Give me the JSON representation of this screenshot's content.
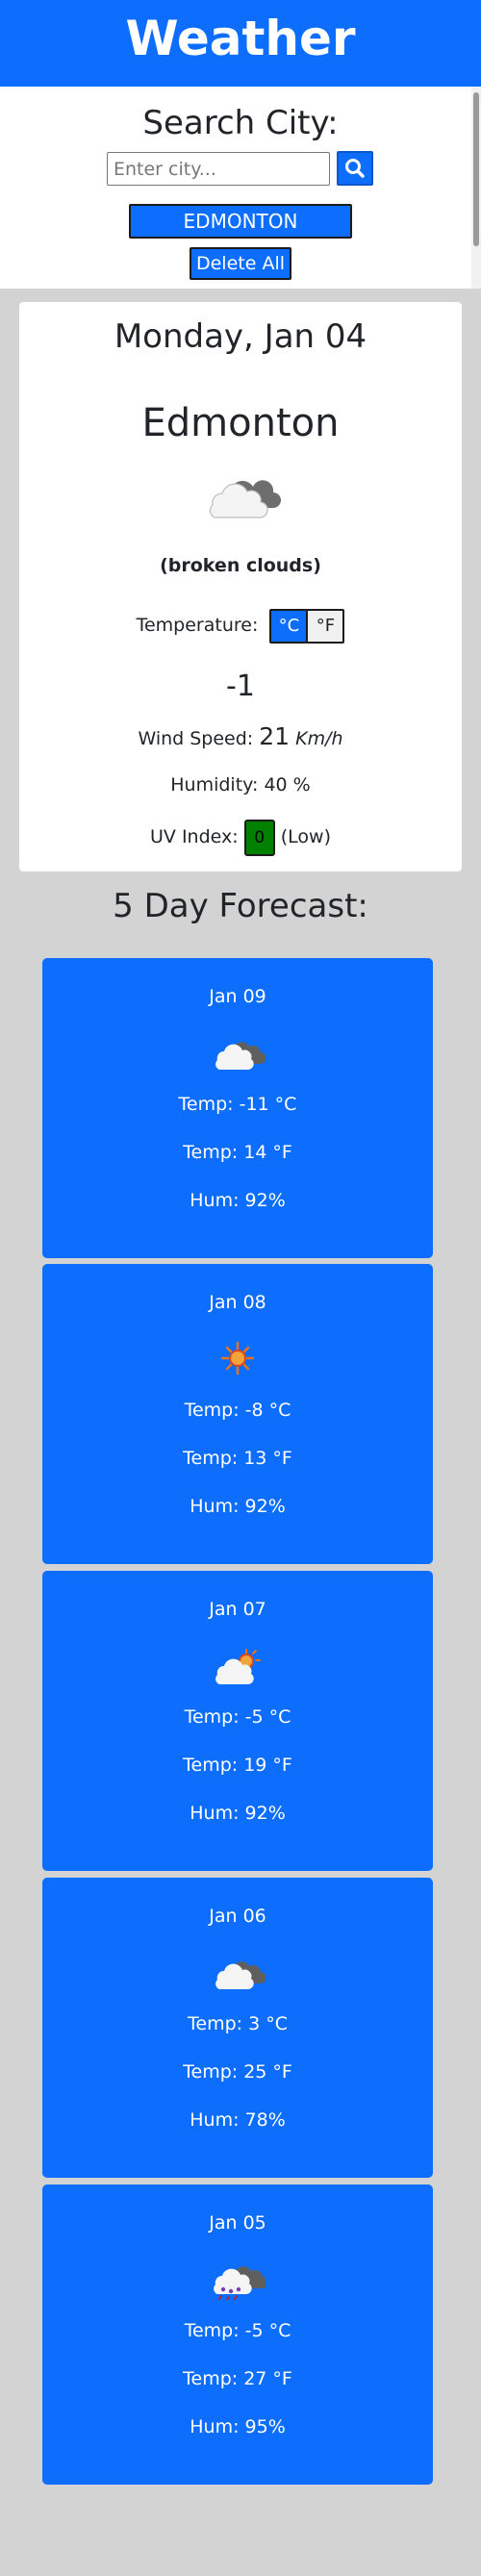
{
  "header": {
    "title": "Weather Dashboard"
  },
  "search": {
    "title": "Search City:",
    "placeholder": "Enter city...",
    "history": [
      "EDMONTON"
    ],
    "delete_label": "Delete All"
  },
  "current": {
    "date": "Monday, Jan 04",
    "city": "Edmonton",
    "icon": "broken-clouds-icon",
    "description": "(broken clouds)",
    "temperature_label": "Temperature:",
    "unit_c": "°C",
    "unit_f": "°F",
    "temperature": "-1",
    "wind_label": "Wind Speed:",
    "wind_value": "21",
    "wind_unit": "Km/h",
    "humidity_text": "Humidity: 40 %",
    "uv_label": "UV Index:",
    "uv_value": "0",
    "uv_level": "(Low)"
  },
  "forecast": {
    "title": "5 Day Forecast:",
    "days": [
      {
        "date": "Jan 09",
        "icon": "cloud-icon",
        "temp_c": "Temp: -11 °C",
        "temp_f": "Temp: 14 °F",
        "hum": "Hum: 92%"
      },
      {
        "date": "Jan 08",
        "icon": "sun-icon",
        "temp_c": "Temp: -8 °C",
        "temp_f": "Temp: 13 °F",
        "hum": "Hum: 92%"
      },
      {
        "date": "Jan 07",
        "icon": "partly-cloudy-icon",
        "temp_c": "Temp: -5 °C",
        "temp_f": "Temp: 19 °F",
        "hum": "Hum: 92%"
      },
      {
        "date": "Jan 06",
        "icon": "cloud-icon",
        "temp_c": "Temp: 3 °C",
        "temp_f": "Temp: 25 °F",
        "hum": "Hum: 78%"
      },
      {
        "date": "Jan 05",
        "icon": "snow-cloud-icon",
        "temp_c": "Temp: -5 °C",
        "temp_f": "Temp: 27 °F",
        "hum": "Hum: 95%"
      }
    ]
  },
  "colors": {
    "accent": "#0d6efd",
    "page_bg": "#d3d3d3",
    "uv_low": "#008000"
  }
}
